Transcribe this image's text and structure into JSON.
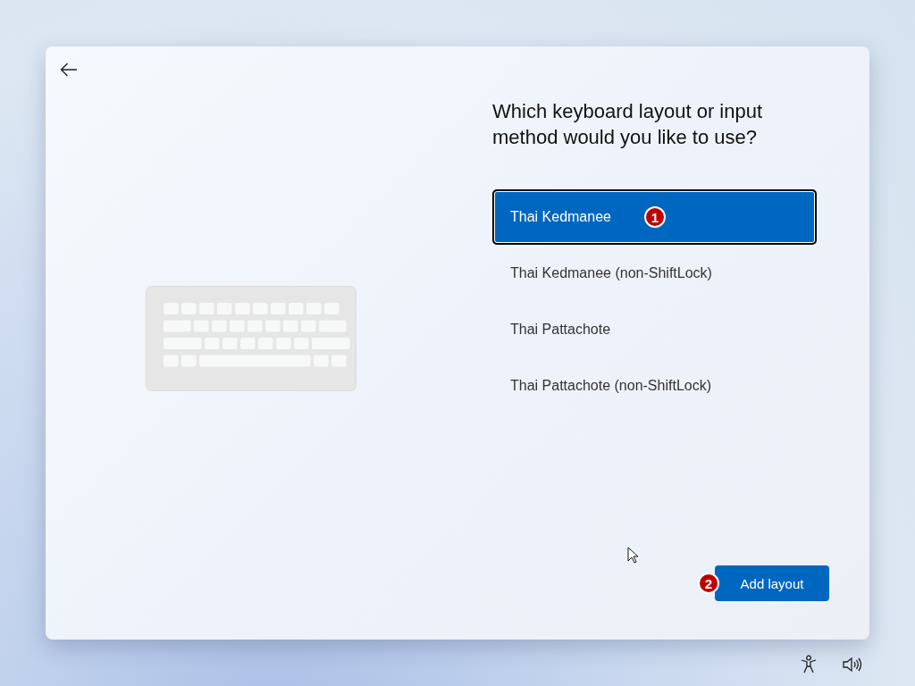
{
  "heading": "Which keyboard layout or input method would you like to use?",
  "layouts": [
    {
      "label": "Thai Kedmanee",
      "selected": true,
      "annotation": "1"
    },
    {
      "label": "Thai Kedmanee (non-ShiftLock)",
      "selected": false
    },
    {
      "label": "Thai Pattachote",
      "selected": false
    },
    {
      "label": "Thai Pattachote (non-ShiftLock)",
      "selected": false
    }
  ],
  "add_button": {
    "label": "Add layout",
    "annotation": "2"
  }
}
